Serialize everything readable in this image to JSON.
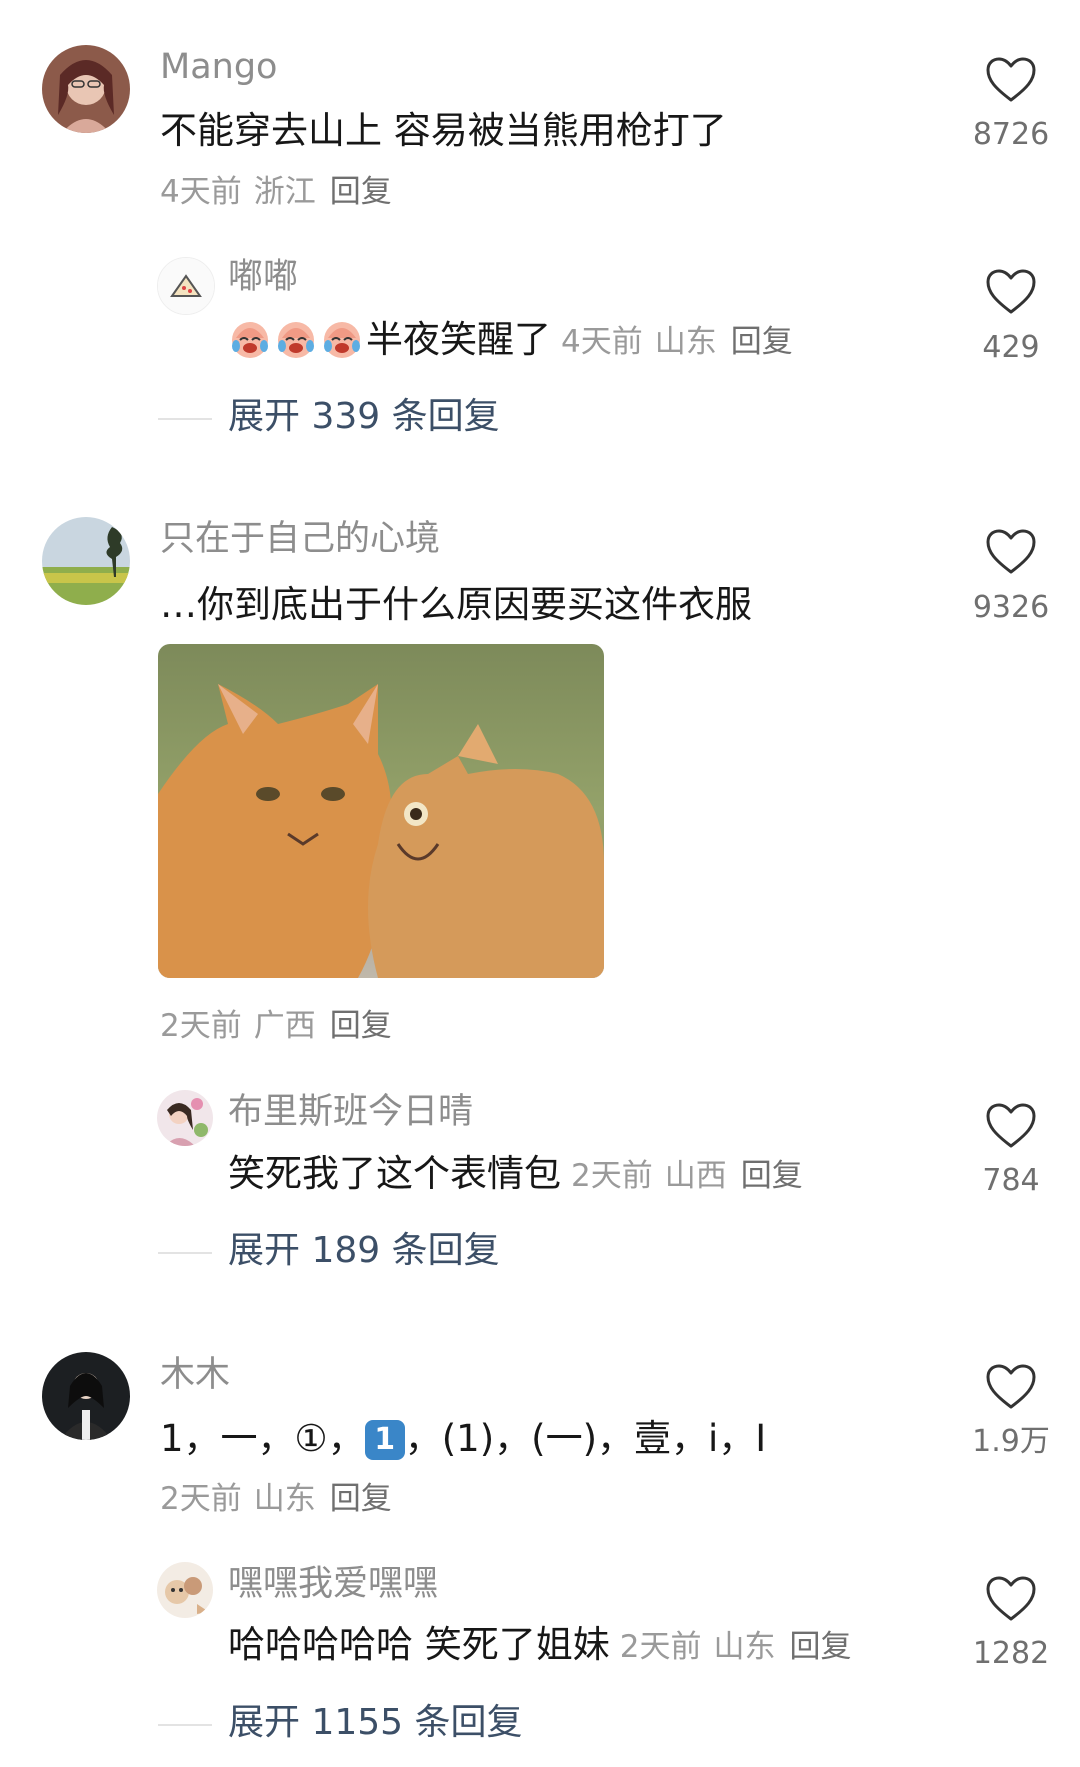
{
  "comments": [
    {
      "username": "Mango",
      "text": "不能穿去山上 容易被当熊用枪打了",
      "time": "4天前",
      "location": "浙江",
      "reply_label": "回复",
      "likes": "8726",
      "sub_reply": {
        "username": "嘟嘟",
        "text": "半夜笑醒了",
        "emoji_names": [
          "crying-laughing-face",
          "crying-laughing-face",
          "crying-laughing-face"
        ],
        "time": "4天前",
        "location": "山东",
        "reply_label": "回复",
        "likes": "429"
      },
      "expand_label": "展开 339 条回复"
    },
    {
      "username": "只在于自己的心境",
      "text": "…你到底出于什么原因要买这件衣服",
      "image_alt": "two orange cats",
      "time": "2天前",
      "location": "广西",
      "reply_label": "回复",
      "likes": "9326",
      "sub_reply": {
        "username": "布里斯班今日晴",
        "text": "笑死我了这个表情包",
        "time": "2天前",
        "location": "山西",
        "reply_label": "回复",
        "likes": "784"
      },
      "expand_label": "展开 189 条回复"
    },
    {
      "username": "木木",
      "text_parts": [
        "1，一，①，",
        "1",
        "，(1)，(一)，壹，ⅰ，Ⅰ"
      ],
      "time": "2天前",
      "location": "山东",
      "reply_label": "回复",
      "likes": "1.9万",
      "sub_reply": {
        "username": "嘿嘿我爱嘿嘿",
        "text": "哈哈哈哈哈 笑死了姐妹",
        "time": "2天前",
        "location": "山东",
        "reply_label": "回复",
        "likes": "1282"
      },
      "expand_label": "展开 1155 条回复"
    }
  ],
  "icons": {
    "like": "heart-outline-icon"
  },
  "colors": {
    "expand_text": "#3c4f67",
    "badge": "#3a86c8",
    "meta": "#9a9a9a"
  }
}
